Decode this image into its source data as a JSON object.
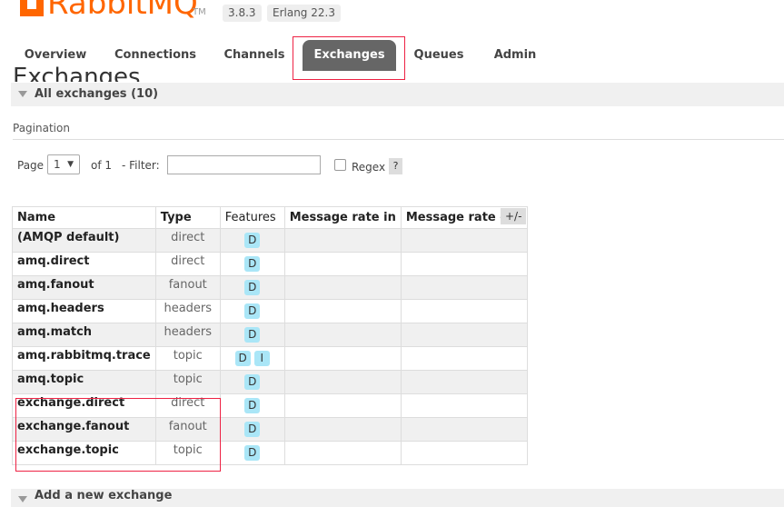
{
  "header": {
    "logo_text": "RabbitMQ",
    "logo_tm": "TM",
    "version": "3.8.3",
    "erlang": "Erlang 22.3"
  },
  "tabs": [
    {
      "label": "Overview"
    },
    {
      "label": "Connections"
    },
    {
      "label": "Channels"
    },
    {
      "label": "Exchanges",
      "active": true
    },
    {
      "label": "Queues"
    },
    {
      "label": "Admin"
    }
  ],
  "page_heading": "Exchanges",
  "section": {
    "title": "All exchanges (10)"
  },
  "pagination": {
    "label": "Pagination",
    "page_label": "Page",
    "page_value": "1",
    "of_label": "of 1",
    "filter_label": "- Filter:",
    "filter_value": "",
    "regex_label": "Regex",
    "regex_checked": false,
    "help_label": "?"
  },
  "table": {
    "columns": [
      "Name",
      "Type",
      "Features",
      "Message rate in",
      "Message rate out"
    ],
    "toggle_label": "+/-",
    "rows": [
      {
        "name": "(AMQP default)",
        "type": "direct",
        "features": [
          "D"
        ],
        "rate_in": "",
        "rate_out": ""
      },
      {
        "name": "amq.direct",
        "type": "direct",
        "features": [
          "D"
        ],
        "rate_in": "",
        "rate_out": ""
      },
      {
        "name": "amq.fanout",
        "type": "fanout",
        "features": [
          "D"
        ],
        "rate_in": "",
        "rate_out": ""
      },
      {
        "name": "amq.headers",
        "type": "headers",
        "features": [
          "D"
        ],
        "rate_in": "",
        "rate_out": ""
      },
      {
        "name": "amq.match",
        "type": "headers",
        "features": [
          "D"
        ],
        "rate_in": "",
        "rate_out": ""
      },
      {
        "name": "amq.rabbitmq.trace",
        "type": "topic",
        "features": [
          "D",
          "I"
        ],
        "rate_in": "",
        "rate_out": ""
      },
      {
        "name": "amq.topic",
        "type": "topic",
        "features": [
          "D"
        ],
        "rate_in": "",
        "rate_out": ""
      },
      {
        "name": "exchange.direct",
        "type": "direct",
        "features": [
          "D"
        ],
        "rate_in": "",
        "rate_out": ""
      },
      {
        "name": "exchange.fanout",
        "type": "fanout",
        "features": [
          "D"
        ],
        "rate_in": "",
        "rate_out": ""
      },
      {
        "name": "exchange.topic",
        "type": "topic",
        "features": [
          "D"
        ],
        "rate_in": "",
        "rate_out": ""
      }
    ]
  },
  "add_section": {
    "title": "Add a new exchange"
  },
  "colors": {
    "brand": "#ff6600",
    "active_tab": "#666666",
    "badge": "#aae6f7",
    "annotation": "#ee2244"
  }
}
